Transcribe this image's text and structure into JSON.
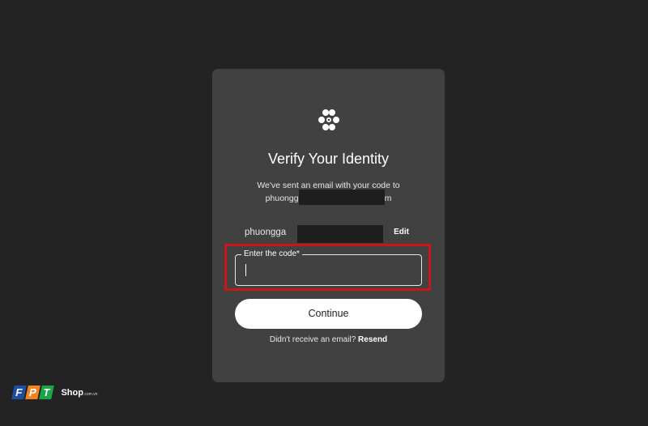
{
  "card": {
    "logo_icon": "flower-logo-icon",
    "title": "Verify Your Identity",
    "sent_message": "We've sent an email with your code to",
    "email_prefix": "phuongg",
    "email_suffix": "m",
    "account_text": "phuongga",
    "edit_label": "Edit",
    "code_field": {
      "label": "Enter the code*",
      "value": ""
    },
    "continue_label": "Continue",
    "resend_prompt": "Didn't receive an email?",
    "resend_label": "Resend"
  },
  "watermark": {
    "letters": [
      "F",
      "P",
      "T"
    ],
    "brand": "Shop",
    "domain": ".com.vn"
  },
  "colors": {
    "background": "#232323",
    "card": "#414141",
    "highlight": "#c8161d",
    "fpt_blue": "#1f4fa3",
    "fpt_orange": "#f58220",
    "fpt_green": "#1ba548"
  }
}
